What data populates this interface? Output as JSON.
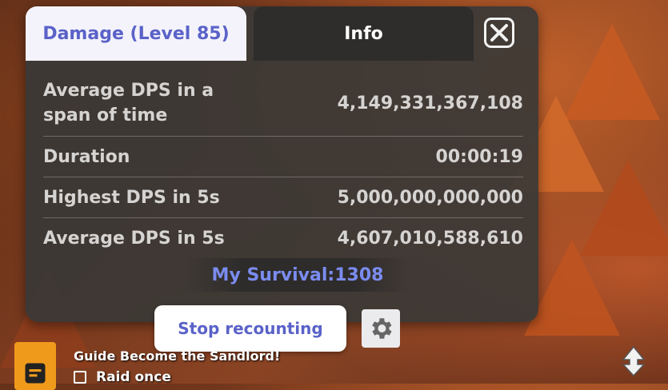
{
  "tabs": {
    "damage_label": "Damage (Level 85)",
    "info_label": "Info"
  },
  "stats": [
    {
      "label": "Average DPS in a span of time",
      "value": "4,149,331,367,108"
    },
    {
      "label": "Duration",
      "value": "00:00:19"
    },
    {
      "label": "Highest DPS in 5s",
      "value": "5,000,000,000,000"
    },
    {
      "label": "Average DPS in 5s",
      "value": "4,607,010,588,610"
    }
  ],
  "survival": "My Survival:1308",
  "buttons": {
    "stop_label": "Stop recounting"
  },
  "quest": {
    "title": "Guide Become the Sandlord!",
    "task": "Raid once"
  },
  "icons": {
    "close": "close-icon",
    "settings": "gear-icon",
    "quest": "quest-document-icon",
    "corner": "navigation-arrows-icon"
  },
  "colors": {
    "accent": "#5a62c8",
    "survival": "#7b8cf0",
    "quest_icon_bg": "#f09a1c"
  }
}
